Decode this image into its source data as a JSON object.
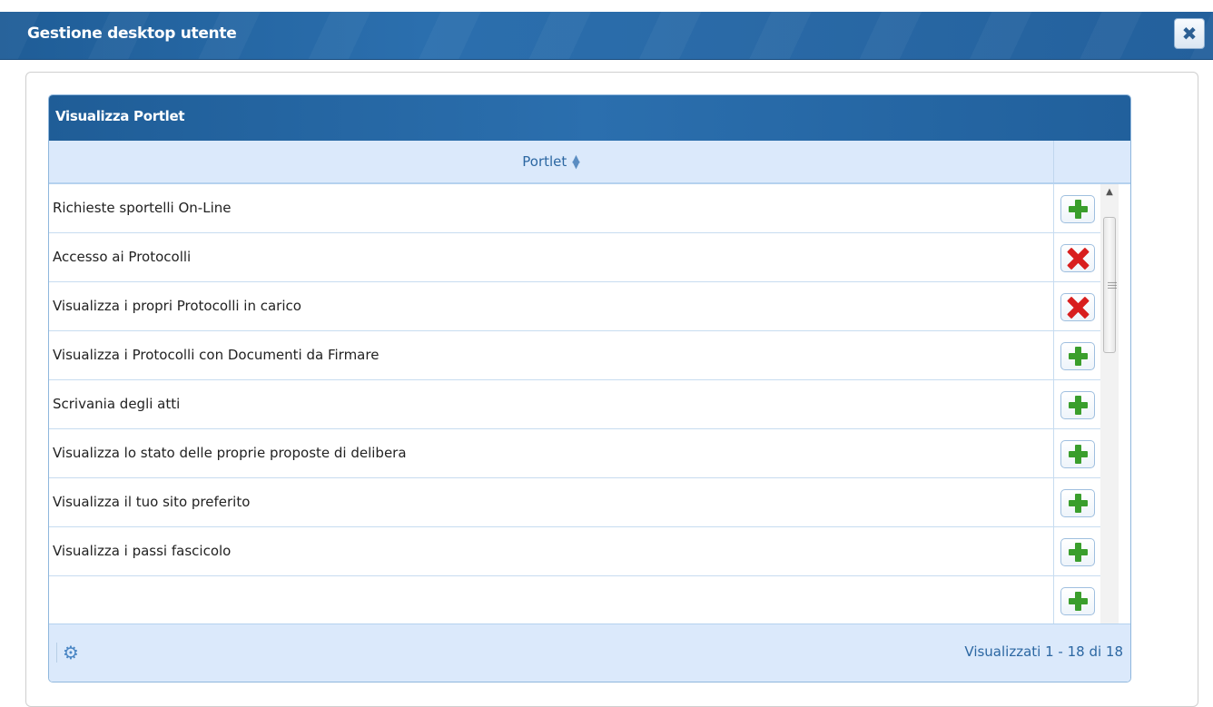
{
  "window": {
    "title": "Gestione desktop utente",
    "close_icon": "close-icon"
  },
  "grid": {
    "caption": "Visualizza Portlet",
    "column_header": "Portlet",
    "rows": [
      {
        "label": "Richieste sportelli On-Line",
        "action": "add"
      },
      {
        "label": "Accesso ai Protocolli",
        "action": "remove"
      },
      {
        "label": "Visualizza i propri Protocolli in carico",
        "action": "remove"
      },
      {
        "label": "Visualizza i Protocolli con Documenti da Firmare",
        "action": "add"
      },
      {
        "label": "Scrivania degli atti",
        "action": "add"
      },
      {
        "label": "Visualizza lo stato delle proprie proposte di delibera",
        "action": "add"
      },
      {
        "label": "Visualizza il tuo sito preferito",
        "action": "add"
      },
      {
        "label": "Visualizza i passi fascicolo",
        "action": "add"
      },
      {
        "label": "",
        "action": "add"
      }
    ],
    "footer_status": "Visualizzati 1 - 18 di 18",
    "settings_icon": "gear-icon",
    "colors": {
      "header_blue": "#2b6fae",
      "add_green": "#3a9e2c",
      "remove_red": "#d81e1e"
    }
  }
}
